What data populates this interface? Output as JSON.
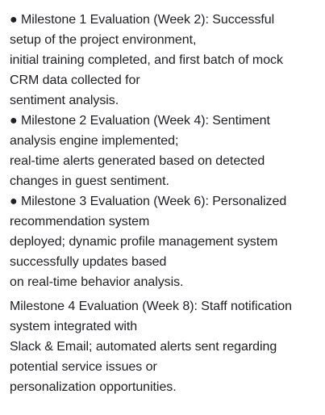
{
  "milestones": [
    {
      "lines": [
        "● Milestone 1 Evaluation (Week 2): Successful",
        "setup of the project environment,",
        "initial training completed, and first batch of mock",
        "CRM data collected for",
        "sentiment analysis."
      ]
    },
    {
      "lines": [
        "● Milestone 2 Evaluation (Week 4): Sentiment",
        "analysis engine implemented;",
        "real-time alerts generated based on detected",
        "changes in guest sentiment."
      ]
    },
    {
      "lines": [
        "● Milestone 3 Evaluation (Week 6): Personalized",
        "recommendation system",
        "deployed; dynamic profile management system",
        "successfully updates based",
        "on real-time behavior analysis."
      ]
    },
    {
      "lines": [
        "Milestone 4 Evaluation (Week 8): Staff notification",
        "system integrated with",
        "Slack & Email; automated alerts sent regarding",
        "potential service issues or",
        "personalization opportunities."
      ]
    }
  ]
}
